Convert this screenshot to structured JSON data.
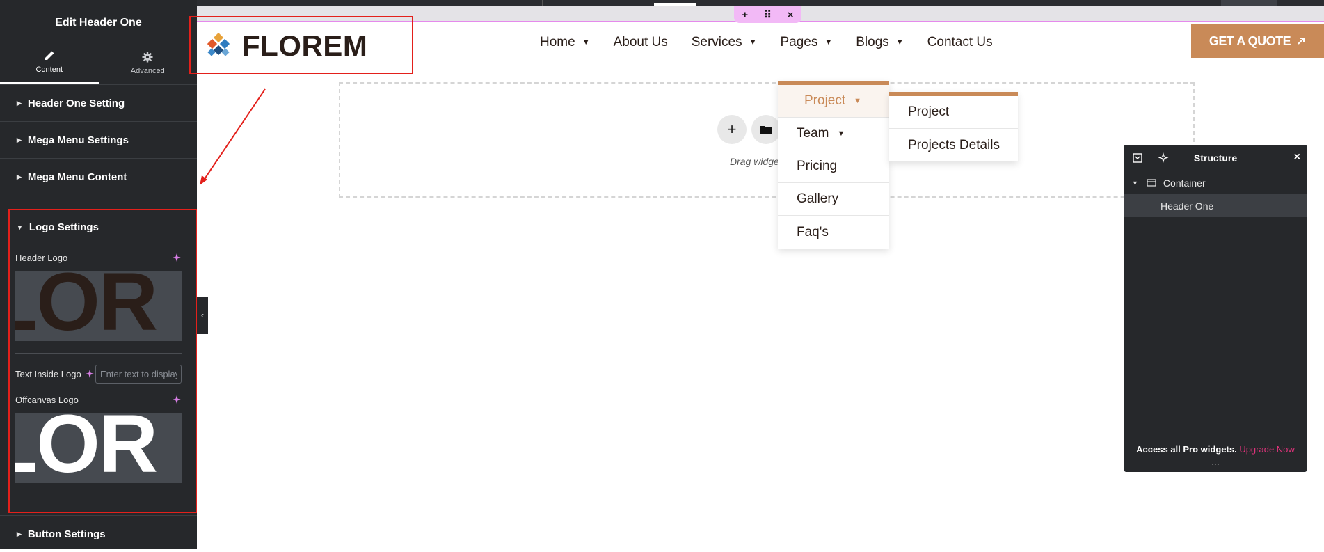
{
  "panel": {
    "title": "Edit Header One",
    "tabs": [
      {
        "label": "Content",
        "icon": "pencil-icon"
      },
      {
        "label": "Advanced",
        "icon": "gear-icon"
      }
    ],
    "sections": [
      "Header One Setting",
      "Mega Menu Settings",
      "Mega Menu Content"
    ],
    "logo_settings": {
      "title": "Logo Settings",
      "header_logo_label": "Header Logo",
      "header_logo_preview_text": "LOR",
      "text_inside_logo_label": "Text Inside Logo",
      "text_inside_logo_placeholder": "Enter text to display",
      "offcanvas_logo_label": "Offcanvas Logo",
      "offcanvas_logo_preview_text": "LOR"
    },
    "button_settings": "Button Settings"
  },
  "header": {
    "logo_text": "FLOREM",
    "nav": [
      {
        "label": "Home",
        "has_dropdown": true
      },
      {
        "label": "About Us",
        "has_dropdown": false
      },
      {
        "label": "Services",
        "has_dropdown": true
      },
      {
        "label": "Pages",
        "has_dropdown": true
      },
      {
        "label": "Blogs",
        "has_dropdown": true
      },
      {
        "label": "Contact Us",
        "has_dropdown": false
      }
    ],
    "cta": "GET A QUOTE"
  },
  "dropdown": {
    "items": [
      "Project",
      "Team",
      "Pricing",
      "Gallery",
      "Faq's"
    ],
    "sub_items": [
      "Project",
      "Projects Details"
    ]
  },
  "canvas": {
    "drag_text": "Drag widge"
  },
  "structure": {
    "title": "Structure",
    "tree": {
      "container": "Container",
      "child": "Header One"
    },
    "promo_text": "Access all Pro widgets.",
    "promo_link": "Upgrade Now"
  },
  "colors": {
    "accent": "#c98a58",
    "panel_bg": "#26282b",
    "highlight_red": "#e3201b",
    "pro_link": "#e2337c",
    "dark_text": "#2a1e19"
  }
}
